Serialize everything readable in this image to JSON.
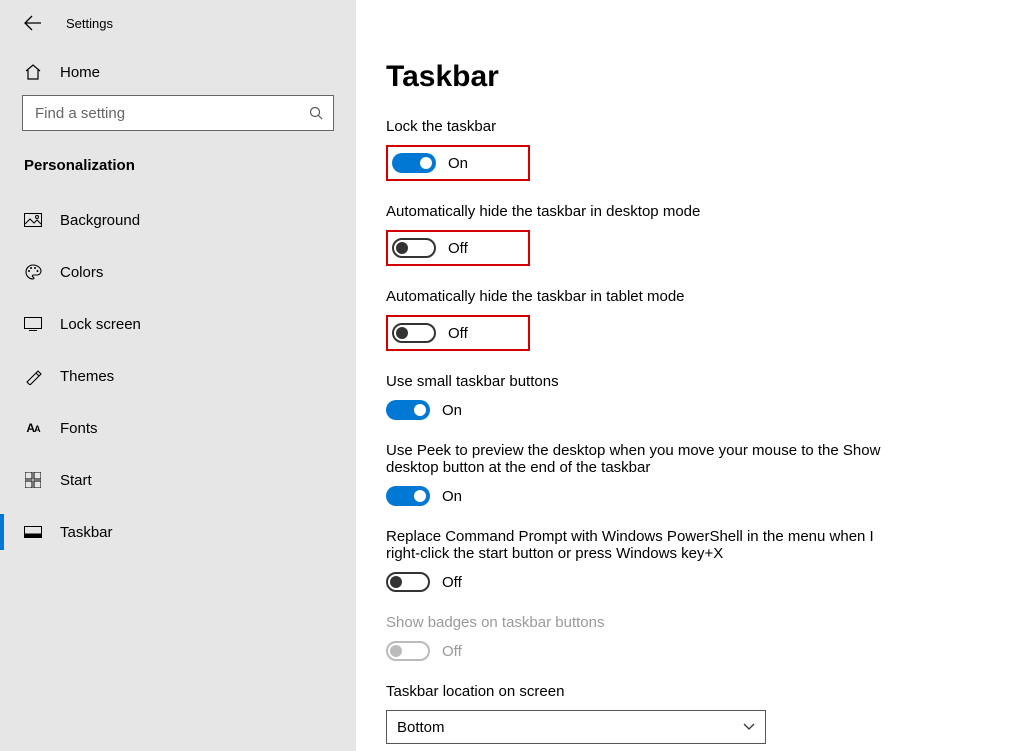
{
  "app_title": "Settings",
  "home_label": "Home",
  "search_placeholder": "Find a setting",
  "category": "Personalization",
  "nav": [
    {
      "label": "Background"
    },
    {
      "label": "Colors"
    },
    {
      "label": "Lock screen"
    },
    {
      "label": "Themes"
    },
    {
      "label": "Fonts"
    },
    {
      "label": "Start"
    },
    {
      "label": "Taskbar"
    }
  ],
  "page_title": "Taskbar",
  "settings": {
    "lock": {
      "label": "Lock the taskbar",
      "state": "On"
    },
    "hide_desktop": {
      "label": "Automatically hide the taskbar in desktop mode",
      "state": "Off"
    },
    "hide_tablet": {
      "label": "Automatically hide the taskbar in tablet mode",
      "state": "Off"
    },
    "small_buttons": {
      "label": "Use small taskbar buttons",
      "state": "On"
    },
    "peek": {
      "label": "Use Peek to preview the desktop when you move your mouse to the Show desktop button at the end of the taskbar",
      "state": "On"
    },
    "powershell": {
      "label": "Replace Command Prompt with Windows PowerShell in the menu when I right-click the start button or press Windows key+X",
      "state": "Off"
    },
    "badges": {
      "label": "Show badges on taskbar buttons",
      "state": "Off"
    },
    "location": {
      "label": "Taskbar location on screen",
      "value": "Bottom"
    }
  }
}
